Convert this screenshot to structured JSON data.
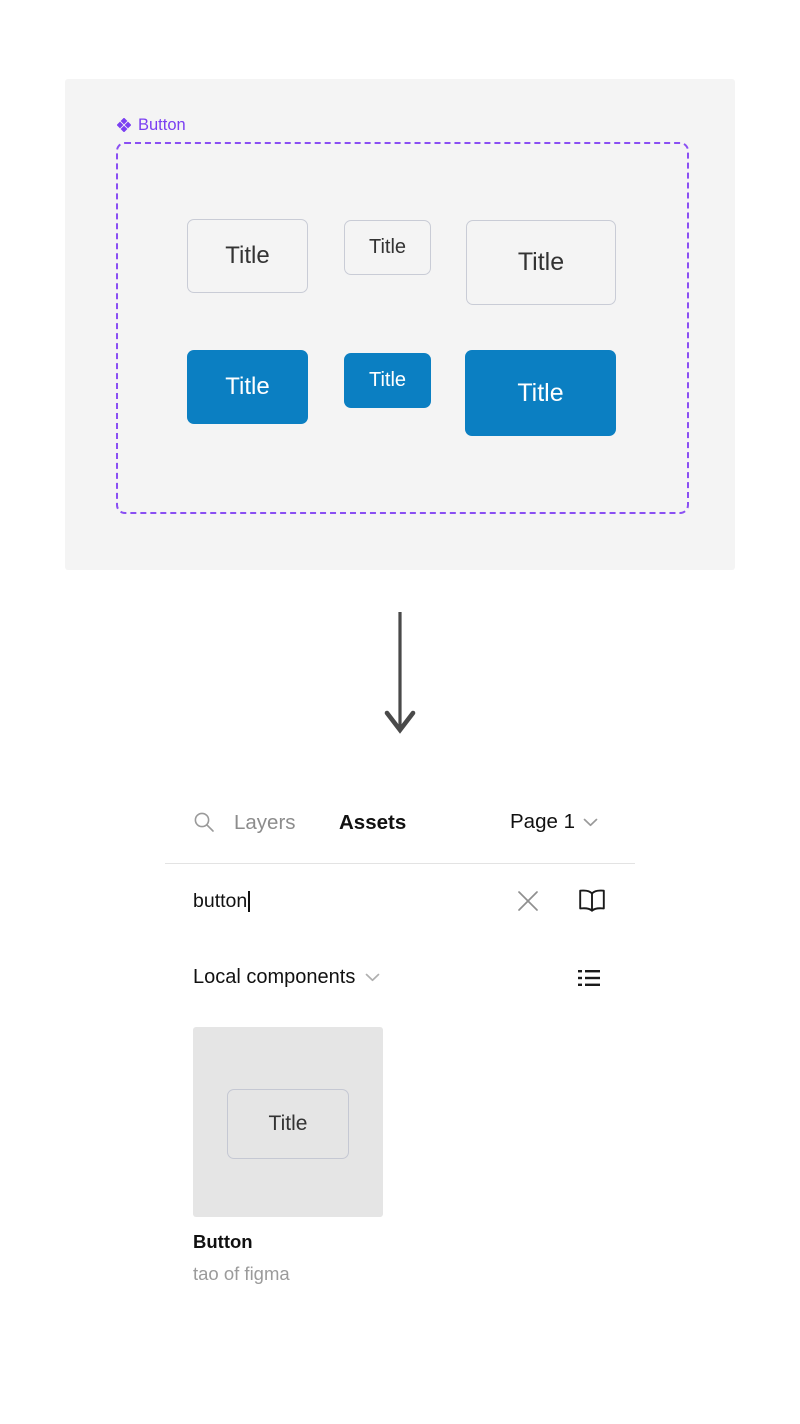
{
  "canvas": {
    "component_label": "Button",
    "component_icon": "component-diamond-icon",
    "selection_border_color": "#8a4ff3",
    "frame_background": "#f4f4f4",
    "buttons": [
      {
        "label": "Title",
        "style": "outline",
        "size": "medium"
      },
      {
        "label": "Title",
        "style": "outline",
        "size": "small"
      },
      {
        "label": "Title",
        "style": "outline",
        "size": "large"
      },
      {
        "label": "Title",
        "style": "filled",
        "size": "medium"
      },
      {
        "label": "Title",
        "style": "filled",
        "size": "small"
      },
      {
        "label": "Title",
        "style": "filled",
        "size": "large"
      }
    ],
    "filled_button_color": "#0b7fc2",
    "outline_button_border_color": "#c9ccd6"
  },
  "arrow": {
    "direction": "down",
    "color": "#4a4a4a"
  },
  "panel": {
    "tabs": [
      {
        "label": "Layers",
        "active": false
      },
      {
        "label": "Assets",
        "active": true
      }
    ],
    "search_icon": "search-icon",
    "page": {
      "label": "Page 1",
      "chevron": "chevron-down-icon"
    },
    "search": {
      "value": "button",
      "placeholder": "Search assets",
      "clear_icon": "close-icon",
      "library_icon": "book-icon"
    },
    "group": {
      "label": "Local components",
      "chevron": "chevron-down-icon",
      "view_icon": "list-view-icon"
    },
    "assets": [
      {
        "name": "Button",
        "subtitle": "tao of figma",
        "preview_label": "Title",
        "thumb_background": "#e5e5e5"
      }
    ]
  }
}
